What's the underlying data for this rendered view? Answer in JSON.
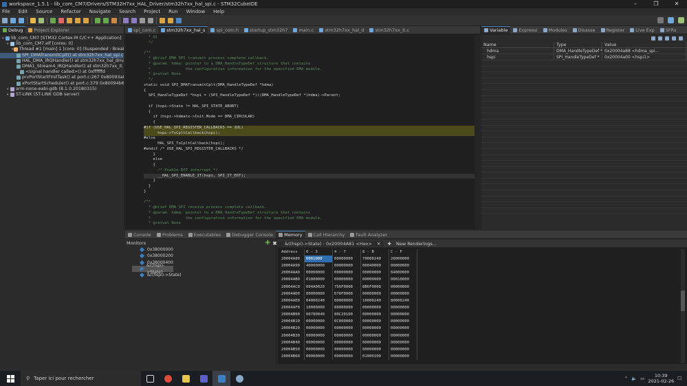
{
  "window": {
    "title": "workspace_1.5.1 - lib_com_CM7/Drivers/STM32H7xx_HAL_Driver/stm32h7xx_hal_spi.c - STM32CubeIDE"
  },
  "menu": [
    "File",
    "Edit",
    "Source",
    "Refactor",
    "Navigate",
    "Search",
    "Project",
    "Run",
    "Window",
    "Help"
  ],
  "left_tabs": {
    "debug": "Debug",
    "project_explorer": "Project Explorer"
  },
  "debug_tree": [
    {
      "indent": 0,
      "text": "lib_com_CM7 [STM32 Cortex-M C/C++ Application]",
      "icon": "#6fa8dc"
    },
    {
      "indent": 1,
      "text": "lib_com_CM7.elf [cores: 0]",
      "icon": "#9fc5e8"
    },
    {
      "indent": 2,
      "text": "Thread #1 [main] 1 [core: 0] (Suspended : Breakpoint)",
      "icon": "#f6b26b"
    },
    {
      "indent": 3,
      "text": "SPI_DMATransmitCplt() at stm32h7xx_hal_spi.c:3,",
      "icon": "#76a5af",
      "sel": true
    },
    {
      "indent": 3,
      "text": "HAL_DMA_IRQHandler() at stm32h7xx_hal_dma.c",
      "icon": "#76a5af"
    },
    {
      "indent": 3,
      "text": "DMA1_Stream4_IRQHandler() at stm32h7xx_it.c:2",
      "icon": "#76a5af"
    },
    {
      "indent": 3,
      "text": "<signal handler called>() at 0xffffffd",
      "icon": "#76a5af"
    },
    {
      "indent": 3,
      "text": "prvPortStartFirstTask() at port.c:267 0x80093a8",
      "icon": "#76a5af"
    },
    {
      "indent": 3,
      "text": "xPortStartScheduler() at port.c:379 0x80094b6",
      "icon": "#76a5af"
    },
    {
      "indent": 1,
      "text": "arm-none-eabi-gdb (8.1.0.20180315)",
      "icon": "#b4a7d6"
    },
    {
      "indent": 1,
      "text": "ST-LINK (ST-LINK GDB server)",
      "icon": "#b4a7d6"
    }
  ],
  "editor_tabs": [
    {
      "label": "spi_com.c"
    },
    {
      "label": "stm32h7xx_hal_s",
      "active": true
    },
    {
      "label": "spi_com.h"
    },
    {
      "label": "startup_stm32h7"
    },
    {
      "label": "main.c"
    },
    {
      "label": "stm32h7xx_hal_d"
    },
    {
      "label": "stm32h7xx_it.c"
    }
  ],
  "code": [
    {
      "n": "3178",
      "t": "  * @}",
      "cls": "cm"
    },
    {
      "n": "3179",
      "t": "  */",
      "cls": "cm"
    },
    {
      "n": "3180",
      "t": ""
    },
    {
      "n": "3181",
      "t": "/**",
      "cls": "cm"
    },
    {
      "n": "3182",
      "t": "  * @brief DMA SPI transmit process complete callback.",
      "cls": "cm"
    },
    {
      "n": "3183",
      "t": "  * @param  hdma: pointer to a DMA_HandleTypeDef structure that contains",
      "cls": "cm"
    },
    {
      "n": "3184",
      "t": "  *               the configuration information for the specified DMA module.",
      "cls": "cm"
    },
    {
      "n": "3185",
      "t": "  * @retval None",
      "cls": "cm"
    },
    {
      "n": "3186",
      "t": "  */",
      "cls": "cm"
    },
    {
      "n": "3187",
      "t": "static void SPI_DMATransmitCplt(DMA_HandleTypeDef *hdma)"
    },
    {
      "n": "3188",
      "t": "{"
    },
    {
      "n": "3189",
      "t": "  SPI_HandleTypeDef *hspi = (SPI_HandleTypeDef *)((DMA_HandleTypeDef *)hdma)->Parent;"
    },
    {
      "n": "3190",
      "t": ""
    },
    {
      "n": "3191",
      "t": "  if (hspi->State != HAL_SPI_STATE_ABORT)"
    },
    {
      "n": "3192",
      "t": "  {"
    },
    {
      "n": "3193",
      "t": "    if (hspi->hdmatx->Init.Mode == DMA_CIRCULAR)"
    },
    {
      "n": "3194",
      "t": "    {"
    },
    {
      "n": "3195",
      "t": "#if (USE_HAL_SPI_REGISTER_CALLBACKS == 1UL)",
      "cls": "hl"
    },
    {
      "n": "3196",
      "t": "      hspi->TxCpltCallback(hspi);",
      "cls": "hl"
    },
    {
      "n": "3197",
      "t": "#else"
    },
    {
      "n": "3198",
      "t": "      HAL_SPI_TxCpltCallback(hspi);"
    },
    {
      "n": "3199",
      "t": "#endif /* USE_HAL_SPI_REGISTER_CALLBACKS */"
    },
    {
      "n": "3200",
      "t": "    }"
    },
    {
      "n": "3201",
      "t": "    else"
    },
    {
      "n": "3202",
      "t": "    {"
    },
    {
      "n": "3203",
      "t": "      /* Enable EOT interrupt */",
      "cls": "cm"
    },
    {
      "n": "3204",
      "t": "      __HAL_SPI_ENABLE_IT(hspi, SPI_IT_EOT);",
      "cls": "cur",
      "arrow": true
    },
    {
      "n": "3205",
      "t": "    }"
    },
    {
      "n": "3206",
      "t": "  }"
    },
    {
      "n": "3207",
      "t": "}"
    },
    {
      "n": "3208",
      "t": ""
    },
    {
      "n": "3209",
      "t": "/**",
      "cls": "cm"
    },
    {
      "n": "3210",
      "t": "  * @brief DMA SPI receive process complete callback.",
      "cls": "cm"
    },
    {
      "n": "3211",
      "t": "  * @param  hdma: pointer to a DMA_HandleTypeDef structure that contains",
      "cls": "cm"
    },
    {
      "n": "3212",
      "t": "  *               the configuration information for the specified DMA module.",
      "cls": "cm"
    },
    {
      "n": "3213",
      "t": "  * @retval None",
      "cls": "cm"
    }
  ],
  "right_tabs": [
    {
      "label": "Variable",
      "active": true
    },
    {
      "label": "Expressi"
    },
    {
      "label": "Modules"
    },
    {
      "label": "Disasse"
    },
    {
      "label": "Register"
    },
    {
      "label": "Live Exp"
    },
    {
      "label": "SFRs"
    }
  ],
  "variables": {
    "headers": [
      "Name",
      "Type",
      "Value"
    ],
    "rows": [
      [
        "hdma",
        "DMA_HandleTypeDef *",
        "0x20004a88 <hdma_spi..."
      ],
      [
        "hspi",
        "SPI_HandleTypeDef *",
        "0x20004a00 <hspi1>"
      ]
    ]
  },
  "bottom_tabs": [
    {
      "label": "Console"
    },
    {
      "label": "Problems"
    },
    {
      "label": "Executables"
    },
    {
      "label": "Debugger Console"
    },
    {
      "label": "Memory",
      "active": true
    },
    {
      "label": "Call Hierarchy"
    },
    {
      "label": "Fault Analyzer"
    }
  ],
  "monitors": {
    "title": "Monitors",
    "items": [
      {
        "text": "0x38000000"
      },
      {
        "text": "0x38000200"
      },
      {
        "text": "0x38000400"
      },
      {
        "text": "&((hspi)->State)",
        "sel": true
      },
      {
        "text": "&((hspi)->State)"
      }
    ]
  },
  "rendering_tabs": {
    "active": "&((hspi)->State) : 0x20004A81 <Hex>",
    "new": "New Renderings..."
  },
  "memory": {
    "headers": [
      "Address",
      "0 - 3",
      "4 - 7",
      "8 - B",
      "C - F"
    ],
    "rows": [
      [
        "20004A80",
        "0001000",
        "00000000",
        "70000240",
        "26000000"
      ],
      [
        "20004A90",
        "40000000",
        "00000000",
        "00040000",
        "00000000"
      ],
      [
        "20004AA0",
        "00000000",
        "00000000",
        "00000000",
        "04000000"
      ],
      [
        "20004AB0",
        "01000000",
        "00000000",
        "00000000",
        "00010000"
      ],
      [
        "20004AC0",
        "004A0020",
        "756F0008",
        "8B6F0008",
        "00000000"
      ],
      [
        "20004AD0",
        "00000000",
        "D76F0008",
        "00000000",
        "00000000"
      ],
      [
        "20004AE0",
        "04000240",
        "00000000",
        "10000240",
        "80000240"
      ],
      [
        "20004AF0",
        "10000000",
        "00000000",
        "00000000",
        "00000000"
      ],
      [
        "20004B00",
        "00780040",
        "00C20100",
        "00000000",
        "00000000"
      ],
      [
        "20004B10",
        "00000000",
        "0C000000",
        "00000000",
        "00000000"
      ],
      [
        "20004B20",
        "00000000",
        "00000000",
        "00000000",
        "00000000"
      ],
      [
        "20004B30",
        "00000000",
        "00000000",
        "00000000",
        "00000000"
      ],
      [
        "20004B40",
        "00000000",
        "00000000",
        "00000000",
        "00000000"
      ],
      [
        "20004B50",
        "00000000",
        "00000000",
        "00000000",
        "00000000"
      ],
      [
        "20004B60",
        "00000000",
        "00000000",
        "01000100",
        "00000000"
      ]
    ]
  },
  "taskbar": {
    "search_placeholder": "Taper ici pour rechercher",
    "time": "10:39",
    "date": "2021-02-26"
  },
  "colors": {
    "accent": "#4c88c5",
    "selection": "#2f6fb1",
    "highlight": "#4a4a1a"
  }
}
